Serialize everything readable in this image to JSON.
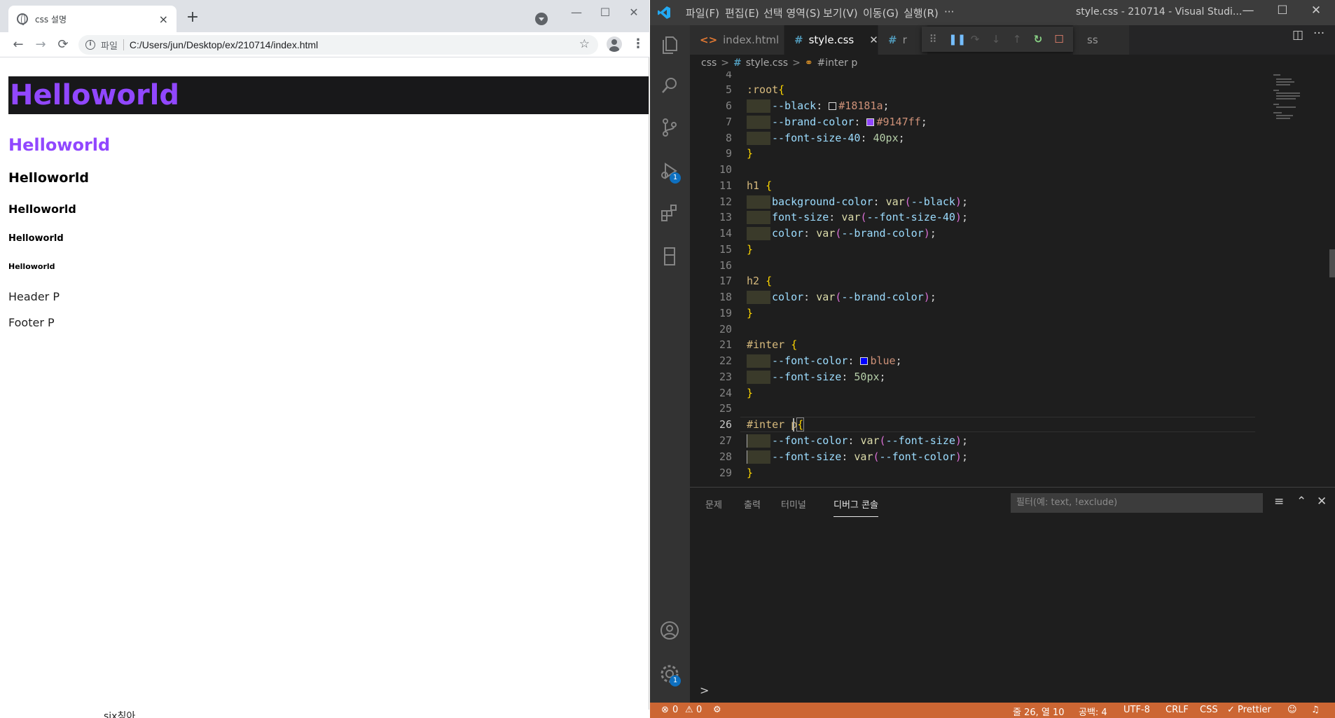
{
  "browser": {
    "tab_title": "css 설명",
    "tab_close": "×",
    "new_tab": "+",
    "window_controls": [
      "—",
      "☐",
      "✕"
    ],
    "nav": {
      "back": "←",
      "forward": "→",
      "reload": "⟳"
    },
    "address": {
      "scheme_label": "파일",
      "url": "C:/Users/jun/Desktop/ex/210714/index.html",
      "info": "i"
    },
    "star": "☆",
    "kebab": "⋮",
    "content": {
      "h1": "Helloworld",
      "h2": "Helloworld",
      "h3": "Helloworld",
      "h4": "Helloworld",
      "h5": "Helloworld",
      "h6": "Helloworld",
      "p_header": "Header P",
      "p_footer": "Footer P"
    },
    "below_window_text": "six칭아"
  },
  "vscode": {
    "menu": [
      "파일(F)",
      "편집(E)",
      "선택 영역(S)",
      "보기(V)",
      "이동(G)",
      "실행(R)",
      "···"
    ],
    "window_title": "style.css - 210714 - Visual Studi...",
    "window_controls": [
      "—",
      "☐",
      "✕"
    ],
    "tabs": [
      {
        "icon": "<>",
        "label": "index.html"
      },
      {
        "icon": "#",
        "label": "style.css",
        "close": "✕"
      },
      {
        "icon": "#",
        "label": "r"
      },
      {
        "label": "ss"
      }
    ],
    "badges": {
      "run": "1",
      "settings": "1"
    },
    "breadcrumb": {
      "folder": "css",
      "sep": ">",
      "hash": "#",
      "file": "style.css",
      "symbol": "#inter p"
    },
    "code_lines": [
      {
        "n": "4"
      },
      {
        "n": "5"
      },
      {
        "n": "6"
      },
      {
        "n": "7"
      },
      {
        "n": "8"
      },
      {
        "n": "9"
      },
      {
        "n": "10"
      },
      {
        "n": "11"
      },
      {
        "n": "12"
      },
      {
        "n": "13"
      },
      {
        "n": "14"
      },
      {
        "n": "15"
      },
      {
        "n": "16"
      },
      {
        "n": "17"
      },
      {
        "n": "18"
      },
      {
        "n": "19"
      },
      {
        "n": "20"
      },
      {
        "n": "21"
      },
      {
        "n": "22"
      },
      {
        "n": "23"
      },
      {
        "n": "24"
      },
      {
        "n": "25"
      },
      {
        "n": "26"
      },
      {
        "n": "27"
      },
      {
        "n": "28"
      },
      {
        "n": "29"
      }
    ],
    "code": {
      "root_sel": ":root",
      "brace_open": "{",
      "brace_close": "}",
      "p_black": "--black",
      "v_black": "#18181a",
      "p_brand": "--brand-color",
      "v_brand": "#9147ff",
      "p_fs40": "--font-size-40",
      "v_fs40": "40px",
      "h1_sel": "h1",
      "p_bg": "background-color",
      "p_fontsize": "font-size",
      "p_color": "color",
      "fn_var": "var",
      "a_black": "--black",
      "a_fs40": "--font-size-40",
      "a_brand": "--brand-color",
      "h2_sel": "h2",
      "inter_sel": "#inter",
      "p_fontcolor": "--font-color",
      "v_blue": "blue",
      "p_fontsize2": "--font-size",
      "v_50px": "50px",
      "interp_sel": "#inter p",
      "a_fontsize": "--font-size",
      "a_fontcolor": "--font-color"
    },
    "swatch_colors": {
      "black": "#18181a",
      "brand": "#9147ff",
      "blue": "#0000ff"
    },
    "panel": {
      "tabs": [
        "문제",
        "출력",
        "터미널",
        "디버그 콘솔"
      ],
      "filter_placeholder": "필터(예: text, !exclude)",
      "prompt": ">"
    },
    "status": {
      "errors": "0",
      "warnings": "0",
      "position": "줄 26, 열 10",
      "spaces": "공백: 4",
      "encoding": "UTF-8",
      "eol": "CRLF",
      "language": "CSS",
      "prettier": "✓ Prettier"
    }
  }
}
